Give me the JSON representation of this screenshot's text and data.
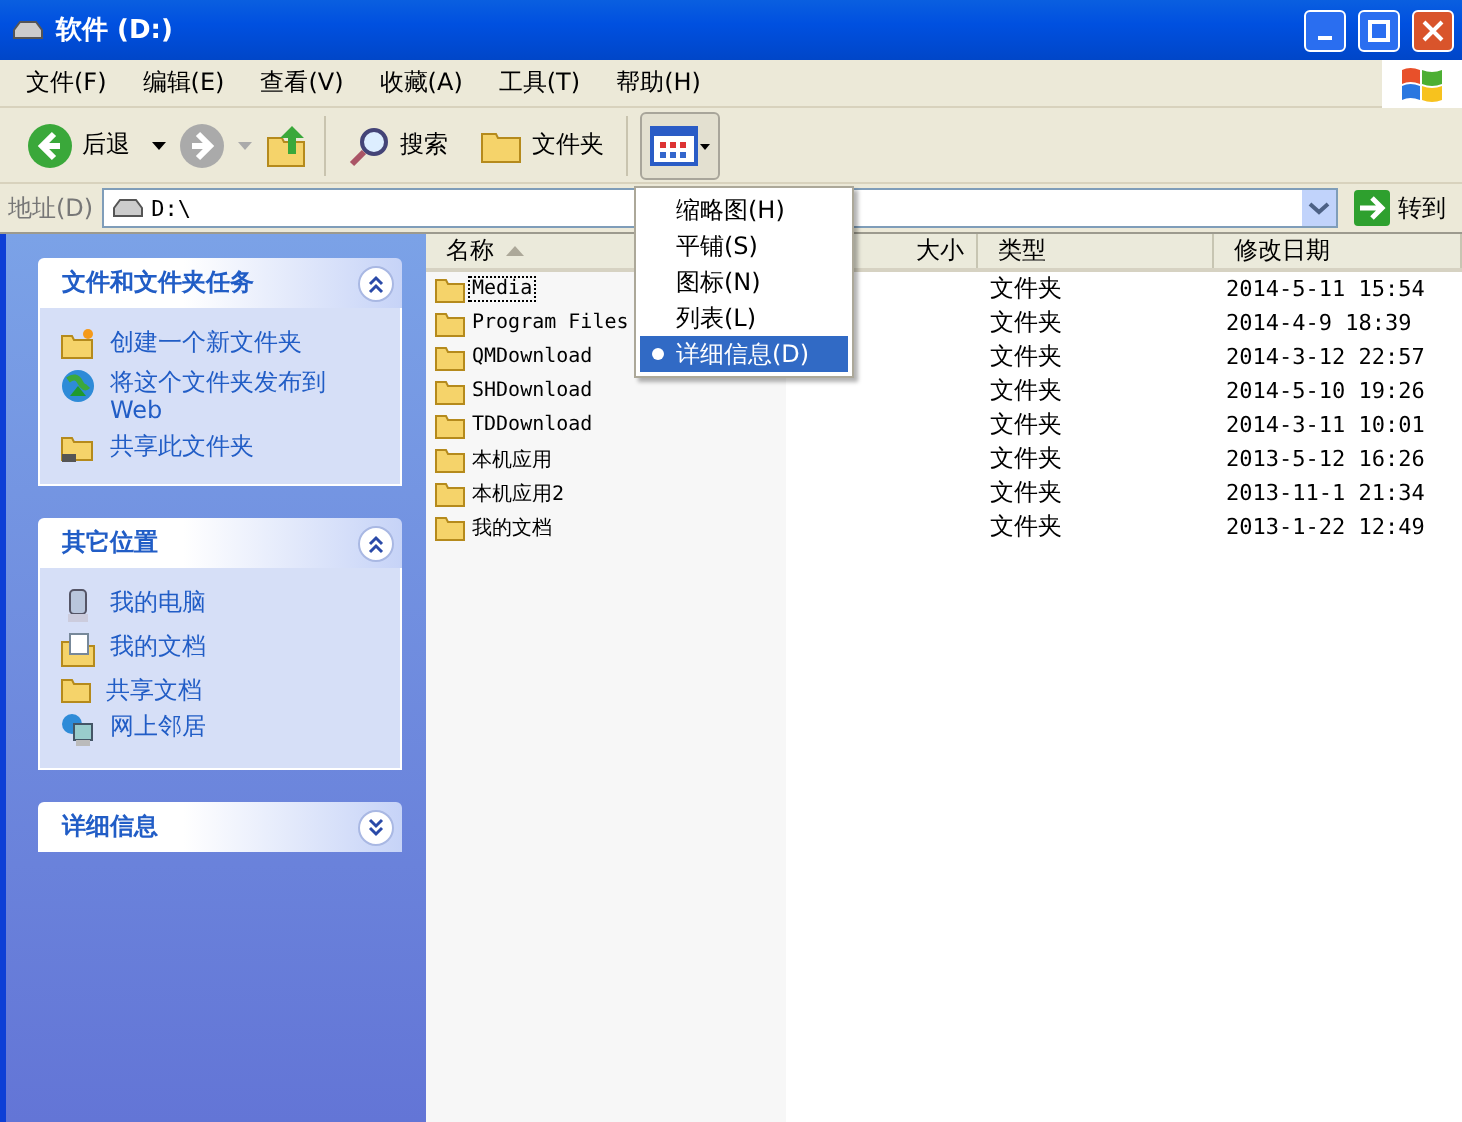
{
  "window": {
    "title": "软件 (D:)"
  },
  "menu": [
    "文件(F)",
    "编辑(E)",
    "查看(V)",
    "收藏(A)",
    "工具(T)",
    "帮助(H)"
  ],
  "toolbar": {
    "back": "后退",
    "search": "搜索",
    "folders": "文件夹"
  },
  "address": {
    "label": "地址(D)",
    "value": "D:\\",
    "go": "转到"
  },
  "view_menu": [
    {
      "label": "缩略图(H)",
      "selected": false
    },
    {
      "label": "平铺(S)",
      "selected": false
    },
    {
      "label": "图标(N)",
      "selected": false
    },
    {
      "label": "列表(L)",
      "selected": false
    },
    {
      "label": "详细信息(D)",
      "selected": true
    }
  ],
  "panels": [
    {
      "title": "文件和文件夹任务",
      "expanded": true,
      "items": [
        {
          "label": "创建一个新文件夹"
        },
        {
          "label": "将这个文件夹发布到 Web"
        },
        {
          "label": "共享此文件夹"
        }
      ]
    },
    {
      "title": "其它位置",
      "expanded": true,
      "items": [
        {
          "label": "我的电脑"
        },
        {
          "label": "我的文档"
        },
        {
          "label": "共享文档"
        },
        {
          "label": "网上邻居"
        }
      ]
    },
    {
      "title": "详细信息",
      "expanded": false
    }
  ],
  "columns": [
    "名称",
    "大小",
    "类型",
    "修改日期"
  ],
  "rows": [
    {
      "name": "Media",
      "type": "文件夹",
      "modified": "2014-5-11 15:54",
      "selected": true
    },
    {
      "name": "Program Files",
      "type": "文件夹",
      "modified": "2014-4-9 18:39",
      "selected": false
    },
    {
      "name": "QMDownload",
      "type": "文件夹",
      "modified": "2014-3-12 22:57",
      "selected": false
    },
    {
      "name": "SHDownload",
      "type": "文件夹",
      "modified": "2014-5-10 19:26",
      "selected": false
    },
    {
      "name": "TDDownload",
      "type": "文件夹",
      "modified": "2014-3-11 10:01",
      "selected": false
    },
    {
      "name": "本机应用",
      "type": "文件夹",
      "modified": "2013-5-12 16:26",
      "selected": false
    },
    {
      "name": "本机应用2",
      "type": "文件夹",
      "modified": "2013-11-1 21:34",
      "selected": false
    },
    {
      "name": "我的文档",
      "type": "文件夹",
      "modified": "2013-1-22 12:49",
      "selected": false
    }
  ]
}
